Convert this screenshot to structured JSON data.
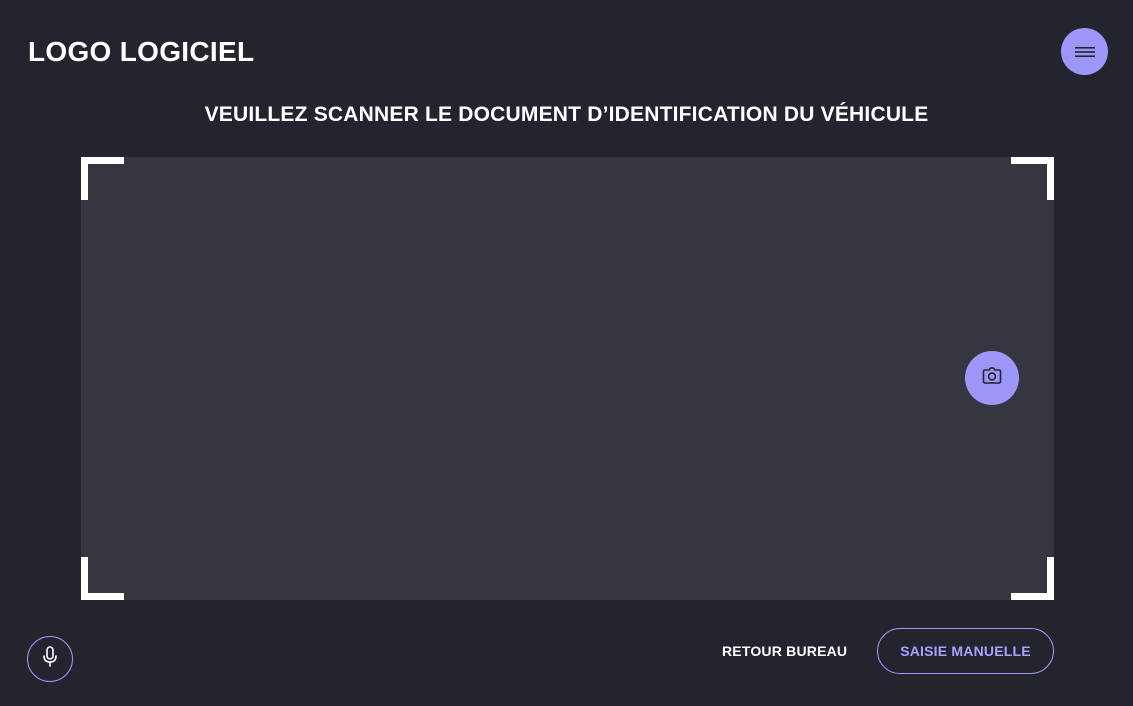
{
  "header": {
    "logo_text": "LOGO LOGICIEL",
    "menu_icon": "hamburger-menu-icon"
  },
  "main": {
    "instruction": "VEUILLEZ SCANNER LE DOCUMENT D’IDENTIFICATION DU VÉHICULE",
    "camera_icon": "camera-icon"
  },
  "footer": {
    "mic_icon": "microphone-icon",
    "back_label": "RETOUR BUREAU",
    "manual_label": "SAISIE MANUELLE"
  },
  "colors": {
    "background": "#24242e",
    "scan_area": "#363641",
    "accent": "#9d97f9",
    "accent_text": "#a8a2ff",
    "text": "#ffffff"
  }
}
